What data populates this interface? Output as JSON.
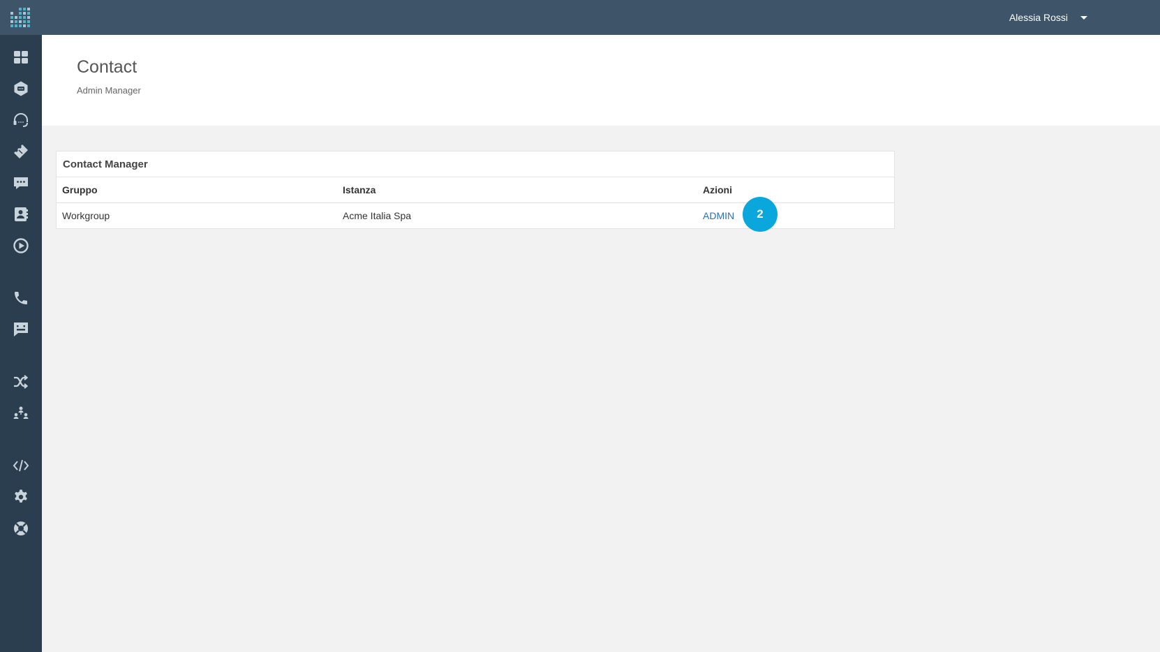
{
  "topbar": {
    "user_name": "Alessia Rossi"
  },
  "sidebar": {
    "items": [
      {
        "icon": "dashboard-icon"
      },
      {
        "icon": "hexagon-chat-icon"
      },
      {
        "icon": "headset-icon"
      },
      {
        "icon": "ticket-icon"
      },
      {
        "icon": "chat-bubble-icon"
      },
      {
        "icon": "contact-book-icon"
      },
      {
        "icon": "play-circle-icon"
      },
      {
        "icon": "phone-icon"
      },
      {
        "icon": "message-icon"
      },
      {
        "icon": "shuffle-icon"
      },
      {
        "icon": "team-icon"
      },
      {
        "icon": "code-icon"
      },
      {
        "icon": "gear-icon"
      },
      {
        "icon": "lifebuoy-icon"
      }
    ]
  },
  "header": {
    "title": "Contact",
    "subtitle": "Admin Manager"
  },
  "panel": {
    "title": "Contact Manager",
    "columns": [
      "Gruppo",
      "Istanza",
      "Azioni"
    ],
    "rows": [
      {
        "gruppo": "Workgroup",
        "istanza": "Acme Italia Spa",
        "azione": "ADMIN"
      }
    ]
  },
  "step_badge": "2",
  "colors": {
    "topbar": "#3d5469",
    "sidebar": "#2b3e50",
    "accent": "#0aa7dd",
    "link": "#2f6fb5"
  }
}
